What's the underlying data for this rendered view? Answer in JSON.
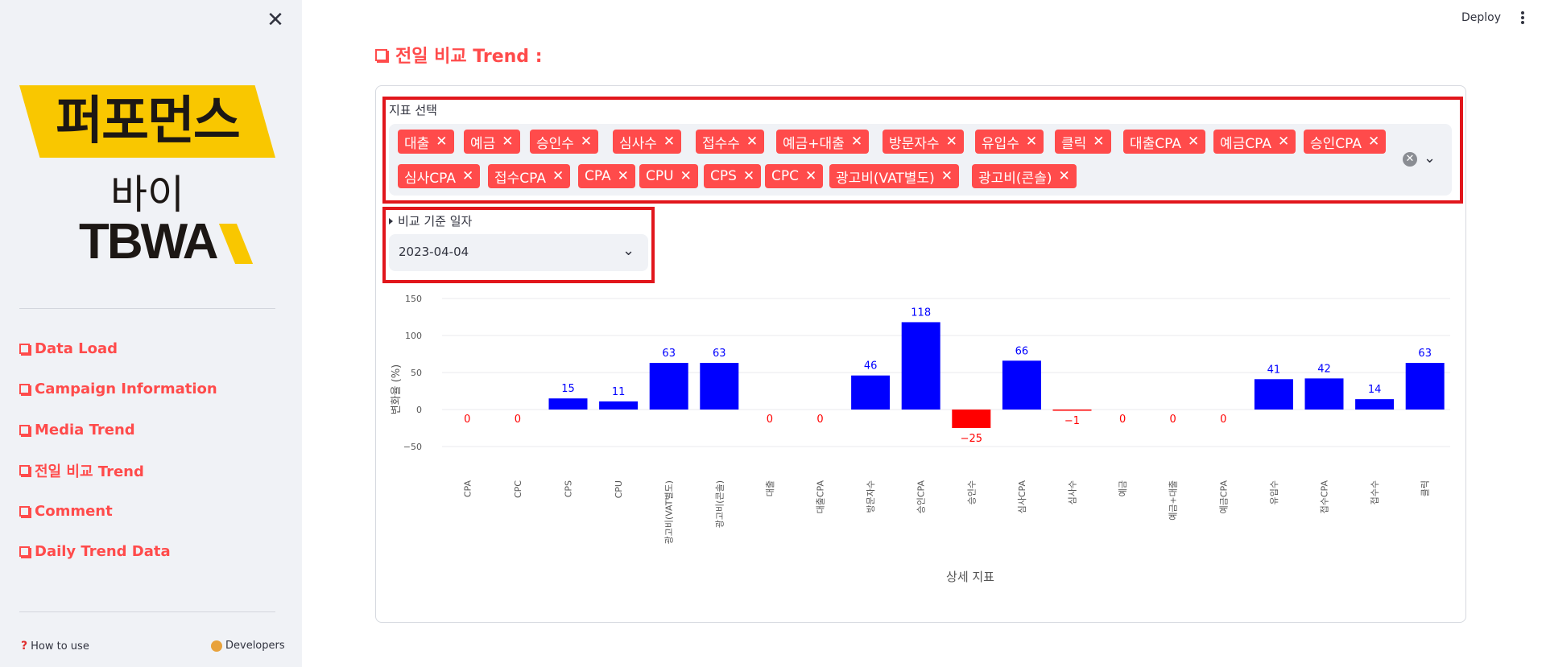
{
  "sidebar": {
    "close_icon": "✕",
    "logo": {
      "kr": "퍼포먼스",
      "by": "바이",
      "brand": "TBWA"
    },
    "nav": [
      {
        "label": "Data Load"
      },
      {
        "label": "Campaign Information"
      },
      {
        "label": "Media Trend"
      },
      {
        "label": "전일 비교 Trend"
      },
      {
        "label": "Comment"
      },
      {
        "label": "Daily Trend Data"
      }
    ],
    "footer": {
      "how_to_use": "How to use",
      "developers": "Developers"
    }
  },
  "topbar": {
    "deploy_label": "Deploy",
    "menu_icon": "kebab-icon"
  },
  "main": {
    "title": "전일 비교 Trend :",
    "metric_select": {
      "label": "지표 선택",
      "chips": [
        "대출",
        "예금",
        "승인수",
        "심사수",
        "접수수",
        "예금+대출",
        "방문자수",
        "유입수",
        "클릭",
        "대출CPA",
        "예금CPA",
        "승인CPA",
        "심사CPA",
        "접수CPA",
        "CPA",
        "CPU",
        "CPS",
        "CPC",
        "광고비(VAT별도)",
        "광고비(콘솔)"
      ]
    },
    "date_select": {
      "label": "비교 기준 일자",
      "value": "2023-04-04"
    }
  },
  "colors": {
    "accent": "#ff4b4b",
    "positive": "#0000ff",
    "negative": "#ff0000",
    "highlight": "#e1161c"
  },
  "chart_data": {
    "type": "bar",
    "categories": [
      "CPA",
      "CPC",
      "CPS",
      "CPU",
      "광고비(VAT별도)",
      "광고비(콘솔)",
      "대출",
      "대출CPA",
      "방문자수",
      "승인CPA",
      "승인수",
      "심사CPA",
      "심사수",
      "예금",
      "예금+대출",
      "예금CPA",
      "유입수",
      "접수CPA",
      "접수수",
      "클릭"
    ],
    "values": [
      0,
      0,
      15,
      11,
      63,
      63,
      0,
      0,
      46,
      118,
      -25,
      66,
      -1,
      0,
      0,
      0,
      41,
      42,
      14,
      63
    ],
    "data_labels": [
      "0",
      "0",
      "15",
      "11",
      "63",
      "63",
      "0",
      "0",
      "46",
      "118",
      "−25",
      "66",
      "−1",
      "0",
      "0",
      "0",
      "41",
      "42",
      "14",
      "63"
    ],
    "yticks": [
      "150",
      "100",
      "50",
      "0",
      "−50"
    ],
    "title": "",
    "xlabel": "상세 지표",
    "ylabel": "변화율 (%)",
    "ylim": [
      -55,
      155
    ],
    "grid": true,
    "positive_color": "#0000ff",
    "negative_color": "#ff0000"
  }
}
